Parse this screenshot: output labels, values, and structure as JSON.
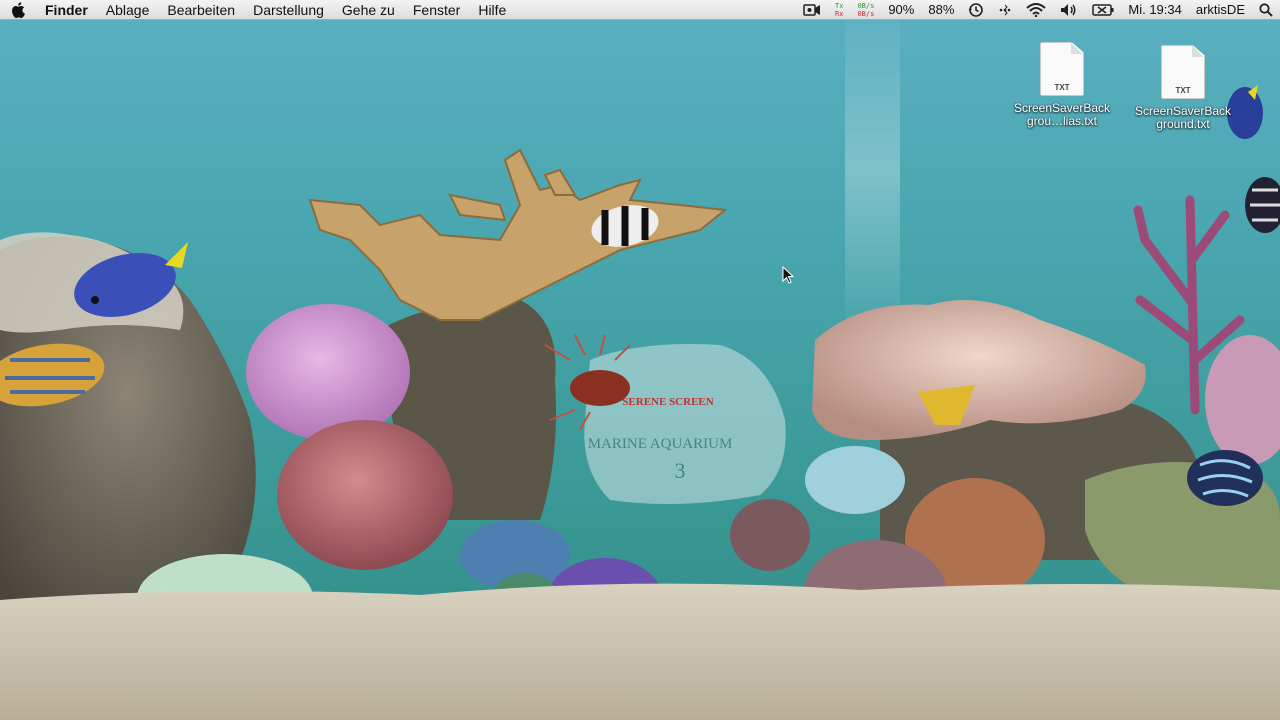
{
  "menubar": {
    "apple_icon": "apple-icon",
    "app_name": "Finder",
    "menus": [
      "Ablage",
      "Bearbeiten",
      "Darstellung",
      "Gehe zu",
      "Fenster",
      "Hilfe"
    ],
    "status": {
      "netmon_tx_label": "Tx",
      "netmon_rx_label": "Rx",
      "netmon_tx_rate": "0B/s",
      "netmon_rx_rate": "0B/s",
      "cpu_percent": "90%",
      "battery_percent": "88%",
      "clock": "Mi. 19:34",
      "user": "arktisDE"
    }
  },
  "desktop": {
    "icons": [
      {
        "type_label": "TXT",
        "name": "ScreenSaverBackgrou…lias.txt"
      },
      {
        "type_label": "TXT",
        "name": "ScreenSaverBackground.txt"
      }
    ],
    "wallpaper": {
      "logo_brand": "SERENE SCREEN",
      "logo_title": "MARINE AQUARIUM",
      "logo_version": "3"
    }
  },
  "colors": {
    "water_top": "#4fa8b8",
    "water_mid": "#3a9a9a",
    "sand": "#cfc6b2",
    "menubar": "#e8e8e8"
  }
}
